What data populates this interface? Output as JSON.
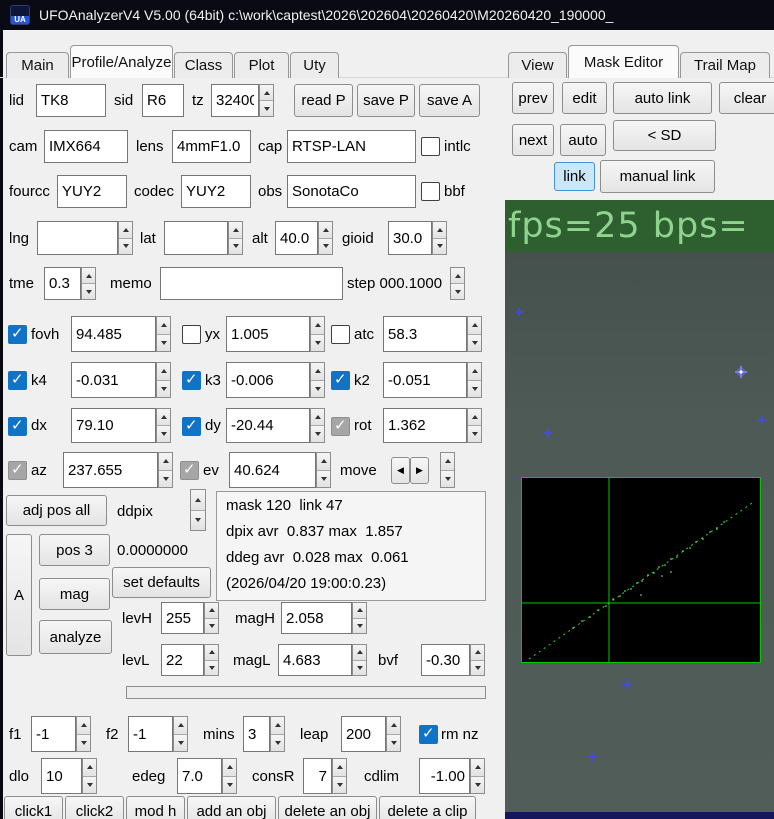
{
  "window": {
    "icon_text": "UA",
    "title": "UFOAnalyzerV4 V5.00 (64bit) c:\\work\\captest\\2026\\202604\\20260420\\M20260420_190000_"
  },
  "tabs": {
    "left": [
      "Main",
      "Profile/Analyze",
      "Class",
      "Plot",
      "Uty"
    ],
    "right": [
      "View",
      "Mask Editor",
      "Trail Map"
    ]
  },
  "profile": {
    "lid": {
      "label": "lid",
      "value": "TK8"
    },
    "sid": {
      "label": "sid",
      "value": "R6"
    },
    "tz": {
      "label": "tz",
      "value": "32400"
    },
    "read_p": "read P",
    "save_p": "save P",
    "save_a": "save A",
    "cam": {
      "label": "cam",
      "value": "IMX664"
    },
    "lens": {
      "label": "lens",
      "value": "4mmF1.0"
    },
    "cap": {
      "label": "cap",
      "value": "RTSP-LAN"
    },
    "intlc": {
      "label": "intlc",
      "checked": false
    },
    "fourcc": {
      "label": "fourcc",
      "value": "YUY2"
    },
    "codec": {
      "label": "codec",
      "value": "YUY2"
    },
    "obs": {
      "label": "obs",
      "value": "SonotaCo"
    },
    "bbf": {
      "label": "bbf",
      "checked": false
    },
    "lng": {
      "label": "lng",
      "value": "",
      "redacted": true
    },
    "lat": {
      "label": "lat",
      "value": "",
      "redacted": true
    },
    "alt": {
      "label": "alt",
      "value": "40.0"
    },
    "gioid": {
      "label": "gioid",
      "value": "30.0"
    },
    "tme": {
      "label": "tme",
      "value": "0.3"
    },
    "memo": {
      "label": "memo",
      "value": ""
    },
    "step_label": "step 000.1000",
    "fovh": {
      "label": "fovh",
      "value": "94.485",
      "checked": true
    },
    "yx": {
      "label": "yx",
      "value": "1.005",
      "checked": false
    },
    "atc": {
      "label": "atc",
      "value": "58.3",
      "checked": false
    },
    "k4": {
      "label": "k4",
      "value": "-0.031",
      "checked": true
    },
    "k3": {
      "label": "k3",
      "value": "-0.006",
      "checked": true
    },
    "k2": {
      "label": "k2",
      "value": "-0.051",
      "checked": true
    },
    "dx": {
      "label": "dx",
      "value": "79.10",
      "checked": true
    },
    "dy": {
      "label": "dy",
      "value": "-20.44",
      "checked": true
    },
    "rot": {
      "label": "rot",
      "value": "1.362",
      "checked": true,
      "disabled": true
    },
    "az": {
      "label": "az",
      "value": "237.655",
      "checked": true,
      "disabled": true
    },
    "ev": {
      "label": "ev",
      "value": "40.624",
      "checked": true,
      "disabled": true
    },
    "move_label": "move",
    "move_left_icon": "◀",
    "move_right_icon": "▶",
    "adj_pos_all": "adj pos all",
    "ddpix_label": "ddpix",
    "info_lines": [
      "mask 120  link 47",
      "dpix avr  0.837 max  1.857",
      "ddeg avr  0.028 max  0.061",
      "(2026/04/20 19:00:0.23)"
    ],
    "a_button": "A",
    "pos_button": "pos 3",
    "pos_value": "0.0000000",
    "set_defaults": "set defaults",
    "mag_button": "mag",
    "levh": {
      "label": "levH",
      "value": "255"
    },
    "magh": {
      "label": "magH",
      "value": "2.058"
    },
    "analyze_button": "analyze",
    "levl": {
      "label": "levL",
      "value": "22"
    },
    "magl": {
      "label": "magL",
      "value": "4.683"
    },
    "bvf": {
      "label": "bvf",
      "value": "-0.30"
    },
    "f1": {
      "label": "f1",
      "value": "-1"
    },
    "f2": {
      "label": "f2",
      "value": "-1"
    },
    "mins": {
      "label": "mins",
      "value": "3"
    },
    "leap": {
      "label": "leap",
      "value": "200"
    },
    "rm_nz": {
      "label": "rm nz",
      "checked": true
    },
    "dlo": {
      "label": "dlo",
      "value": "10"
    },
    "edeg": {
      "label": "edeg",
      "value": "7.0"
    },
    "consr": {
      "label": "consR",
      "value": "7"
    },
    "cdlim": {
      "label": "cdlim",
      "value": "-1.00"
    },
    "bottom_buttons": [
      "click1",
      "click2",
      "mod h",
      "add an obj",
      "delete an obj",
      "delete a clip"
    ]
  },
  "mask_editor": {
    "prev": "prev",
    "edit": "edit",
    "auto_link": "auto link",
    "clear": "clear",
    "next": "next",
    "auto": "auto",
    "sd": "< SD",
    "link": "link",
    "manual_link": "manual link",
    "video_overlay": "fps=25 bps=",
    "colors": {
      "overlay_text": "#8fd38f",
      "overlay_band": "#2d5f2f",
      "marker": "#4646ff",
      "inset_line": "#00c800"
    }
  }
}
